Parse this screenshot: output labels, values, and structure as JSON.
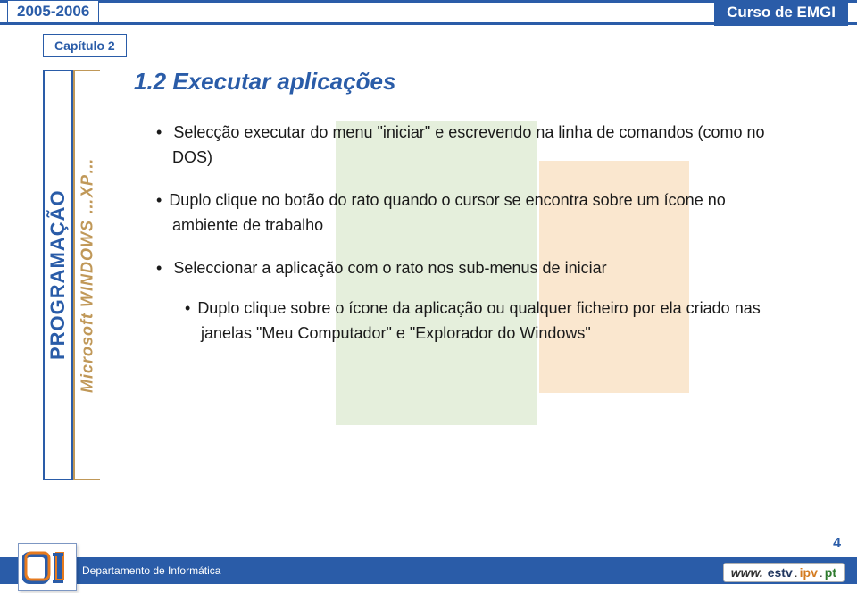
{
  "header": {
    "year": "2005-2006",
    "course": "Curso de EMGI",
    "chapter": "Capítulo 2"
  },
  "sidebar": {
    "programacao": "PROGRAMAÇÃO",
    "winxp": "Microsoft WINDOWS …XP…"
  },
  "section": {
    "title": "1.2 Executar aplicações"
  },
  "bullets": {
    "b1_pre": "Selecção executar do menu \"iniciar\" e escrevendo na linha de comandos (como no ",
    "b1_dos": "DOS",
    "b1_post": ")",
    "b2": "Duplo clique no botão do rato quando o cursor se encontra sobre um ícone no ambiente de trabalho",
    "b3": "Seleccionar a aplicação com o rato nos sub-menus de  iniciar",
    "b3_sub": "Duplo clique sobre o ícone da aplicação ou qualquer ficheiro por ela criado nas janelas \"Meu Computador\" e \"Explorador do Windows\""
  },
  "footer": {
    "department": "Departamento de Informática",
    "page": "4",
    "url_www": "www.",
    "url_estv": "estv",
    "url_ipv": "ipv",
    "url_pt": "pt"
  }
}
